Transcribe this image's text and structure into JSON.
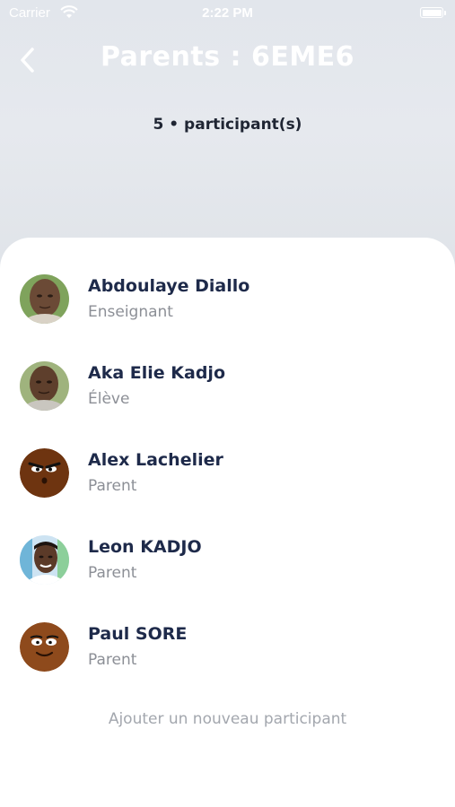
{
  "status": {
    "carrier": "Carrier",
    "time": "2:22 PM"
  },
  "header": {
    "title": "Parents : 6EME6",
    "count_text": "5 • participant(s)"
  },
  "participants": [
    {
      "name": "Abdoulaye Diallo",
      "role": "Enseignant",
      "avatar": "photo"
    },
    {
      "name": "Aka Elie Kadjo",
      "role": "Élève",
      "avatar": "photo"
    },
    {
      "name": "Alex Lachelier",
      "role": "Parent",
      "avatar": "cartoon-angry"
    },
    {
      "name": "Leon KADJO",
      "role": "Parent",
      "avatar": "photo"
    },
    {
      "name": "Paul SORE",
      "role": "Parent",
      "avatar": "cartoon-smile"
    }
  ],
  "add_participant_label": "Ajouter un nouveau participant",
  "colors": {
    "name": "#1e2a4a",
    "role": "#8c8f96",
    "cartoon_skin": "#7a3f12"
  }
}
